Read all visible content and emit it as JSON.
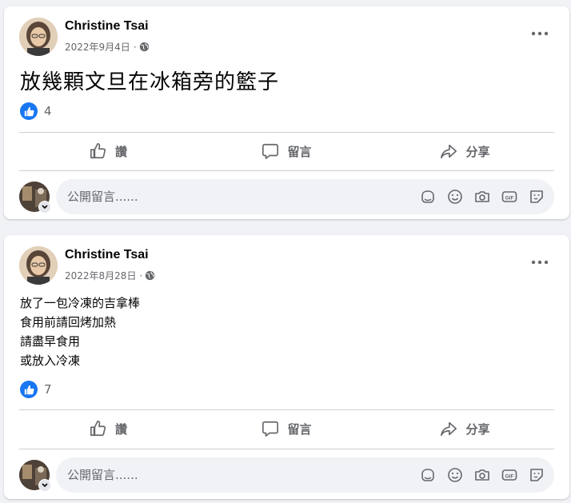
{
  "colors": {
    "accent": "#1877f2",
    "secondary_text": "#65676b",
    "background": "#f0f2f5"
  },
  "posts": [
    {
      "author": "Christine Tsai",
      "date": "2022年9月4日",
      "privacy_icon": "globe-icon",
      "content_lines": [
        "放幾顆文旦在冰箱旁的籃子"
      ],
      "like_count": "4",
      "actions": {
        "like": "讚",
        "comment": "留言",
        "share": "分享"
      },
      "comment_placeholder": "公開留言......"
    },
    {
      "author": "Christine Tsai",
      "date": "2022年8月28日",
      "privacy_icon": "globe-icon",
      "content_lines": [
        "放了一包冷凍的吉拿棒",
        "食用前請回烤加熱",
        "請盡早食用",
        "或放入冷凍"
      ],
      "like_count": "7",
      "actions": {
        "like": "讚",
        "comment": "留言",
        "share": "分享"
      },
      "comment_placeholder": "公開留言......"
    }
  ],
  "comment_toolbar_icons": [
    "avatar-sticker-icon",
    "emoji-icon",
    "camera-icon",
    "gif-icon",
    "sticker-icon"
  ]
}
